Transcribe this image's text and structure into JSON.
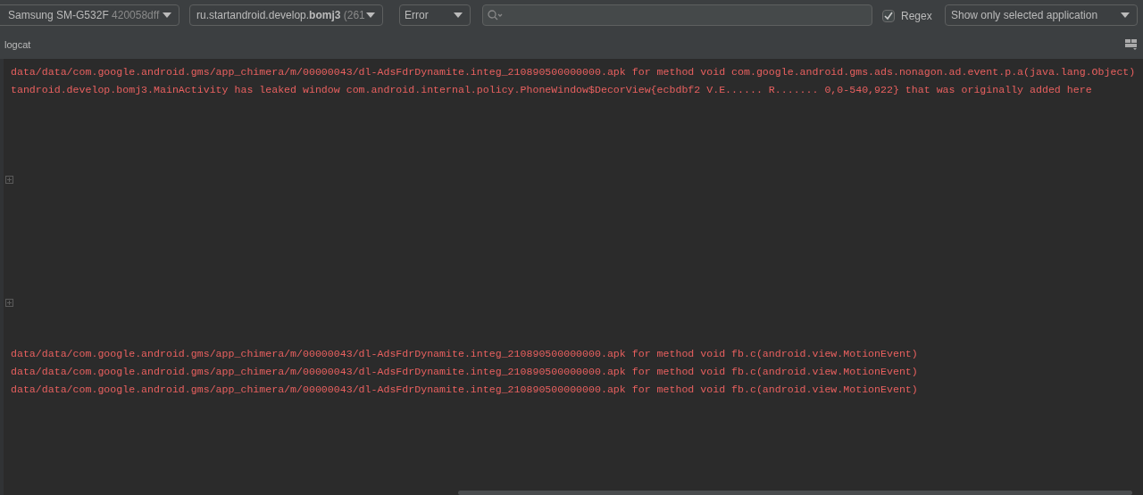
{
  "toolbar": {
    "device": {
      "name": "Samsung SM-G532F",
      "serial": "420058dff"
    },
    "process": {
      "name": "ru.startandroid.develop.**bomj3**",
      "pid": "(261"
    },
    "log_level": "Error",
    "regex": {
      "label": "Regex",
      "checked": true
    },
    "filter": "Show only selected application"
  },
  "panel": {
    "title": "logcat"
  },
  "log": [
    {
      "kind": "line",
      "text": "data/data/com.google.android.gms/app_chimera/m/00000043/dl-AdsFdrDynamite.integ_210890500000000.apk for method void com.google.android.gms.ads.nonagon.ad.event.p.a(java.lang.Object)"
    },
    {
      "kind": "line",
      "text": "tandroid.develop.bomj3.MainActivity has leaked window com.android.internal.policy.PhoneWindow$DecorView{ecbdbf2 V.E...... R....... 0,0-540,922} that was originally added here"
    },
    {
      "kind": "fold"
    },
    {
      "kind": "fold"
    },
    {
      "kind": "line",
      "text": "data/data/com.google.android.gms/app_chimera/m/00000043/dl-AdsFdrDynamite.integ_210890500000000.apk for method void fb.c(android.view.MotionEvent)"
    },
    {
      "kind": "line",
      "text": "data/data/com.google.android.gms/app_chimera/m/00000043/dl-AdsFdrDynamite.integ_210890500000000.apk for method void fb.c(android.view.MotionEvent)"
    },
    {
      "kind": "line",
      "text": "data/data/com.google.android.gms/app_chimera/m/00000043/dl-AdsFdrDynamite.integ_210890500000000.apk for method void fb.c(android.view.MotionEvent)"
    }
  ]
}
